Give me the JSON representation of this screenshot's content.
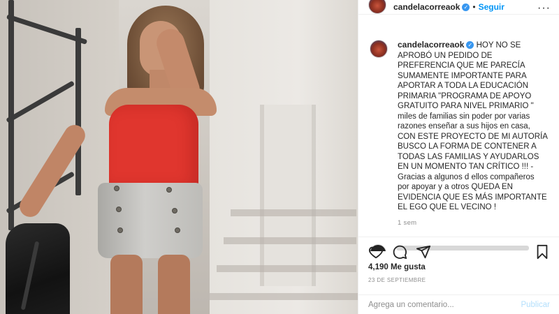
{
  "post": {
    "username": "candelacorreaok",
    "verified_mark": "✓",
    "separator": "•",
    "follow_label": "Seguir",
    "more_label": "···",
    "caption": "HOY NO SE APROBÓ UN PEDIDO DE PREFERENCIA QUE ME PARECÍA SUMAMENTE IMPORTANTE PARA APORTAR A TODA LA EDUCACIÓN PRIMARIA \"PROGRAMA DE APOYO GRATUITO PARA NIVEL PRIMARIO \" miles de familias sin poder por varias razones enseñar a sus hijos en casa, CON ESTE PROYECTO DE MI AUTORÍA BUSCO LA FORMA DE CONTENER A TODAS LAS FAMILIAS Y AYUDARLOS EN UN MOMENTO TAN CRÍTICO !!! - Gracias a algunos d ellos compañeros por apoyar y a otros QUEDA EN EVIDENCIA QUE ES MÁS IMPORTANTE EL EGO QUE EL VECINO !",
    "caption_age": "1 sem",
    "likes": "4,190 Me gusta",
    "date": "23 DE SEPTIEMBRE",
    "comment_placeholder": "Agrega un comentario...",
    "publish_label": "Publicar"
  },
  "icons": {
    "like": "heart-icon",
    "comment": "comment-icon",
    "share": "share-icon",
    "save": "bookmark-icon",
    "more": "more-icon"
  },
  "colors": {
    "link_blue": "#0095f6",
    "verified_blue": "#3897f0",
    "muted": "#8e8e8e",
    "publish_disabled": "#b2dffc"
  }
}
